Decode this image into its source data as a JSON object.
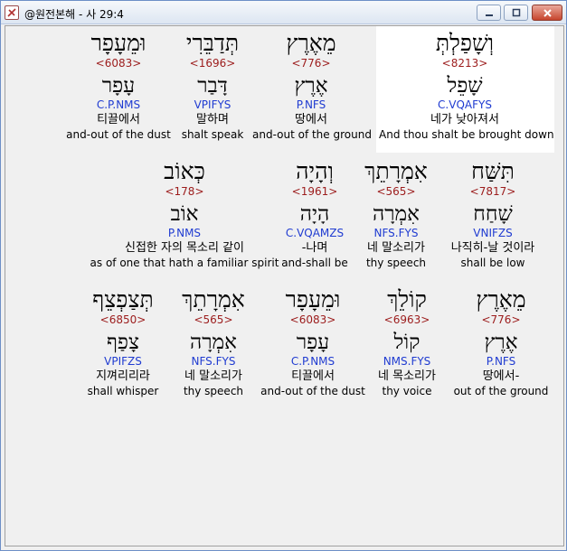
{
  "window": {
    "title": "@원전본해 - 사 29:4"
  },
  "rows": [
    [
      {
        "heb": "וּמֵעָפָר",
        "strong": "<6083>",
        "root": "עָפָר",
        "morph": "C.P.NMS",
        "kor": "티끌에서",
        "eng": "and-out of the dust"
      },
      {
        "heb": "תְּדַבֵּרִי",
        "strong": "<1696>",
        "root": "דָּבַר",
        "morph": "VPIFYS",
        "kor": "말하며",
        "eng": "shalt speak"
      },
      {
        "heb": "מֵאֶרֶץ",
        "strong": "<776>",
        "root": "אֶרֶץ",
        "morph": "P.NFS",
        "kor": "땅에서",
        "eng": "and-out of the ground"
      },
      {
        "heb": "וְשָׁפַלְתְּ",
        "strong": "<8213>",
        "root": "שָׁפֵל",
        "morph": "C.VQAFYS",
        "kor": "네가 낮아져서",
        "eng": "And thou shalt be brought down",
        "highlight": true
      }
    ],
    [
      {
        "heb": "כְּאוֹב",
        "strong": "<178>",
        "root": "אוֹב",
        "morph": "P.NMS",
        "kor": "신접한 자의 목소리 같이",
        "eng": "as of one that hath a familiar spirit"
      },
      {
        "heb": "וְהָיָה",
        "strong": "<1961>",
        "root": "הָיָה",
        "morph": "C.VQAMZS",
        "kor": "-나며",
        "eng": "and-shall be"
      },
      {
        "heb": "אִמְרָתֵךְ",
        "strong": "<565>",
        "root": "אִמְרָה",
        "morph": "NFS.FYS",
        "kor": "네 말소리가",
        "eng": "thy speech"
      },
      {
        "heb": "תִּשַּׁח",
        "strong": "<7817>",
        "root": "שָׁחַח",
        "morph": "VNIFZS",
        "kor": "나직히-날 것이라",
        "eng": "shall be low"
      }
    ],
    [
      {
        "heb": "תְּצַפְצֵף",
        "strong": "<6850>",
        "root": "צָפַף",
        "morph": "VPIFZS",
        "kor": "지껴리리라",
        "eng": "shall whisper"
      },
      {
        "heb": "אִמְרָתֵךְ",
        "strong": "<565>",
        "root": "אִמְרָה",
        "morph": "NFS.FYS",
        "kor": "네 말소리가",
        "eng": "thy speech"
      },
      {
        "heb": "וּמֵעָפָר",
        "strong": "<6083>",
        "root": "עָפָר",
        "morph": "C.P.NMS",
        "kor": "티끌에서",
        "eng": "and-out of the dust"
      },
      {
        "heb": "קוֹלֵךְ",
        "strong": "<6963>",
        "root": "קוֹל",
        "morph": "NMS.FYS",
        "kor": "네 목소리가",
        "eng": "thy voice"
      },
      {
        "heb": "מֵאֶרֶץ",
        "strong": "<776>",
        "root": "אֶרֶץ",
        "morph": "P.NFS",
        "kor": "땅에서-",
        "eng": "out of the ground"
      }
    ]
  ]
}
